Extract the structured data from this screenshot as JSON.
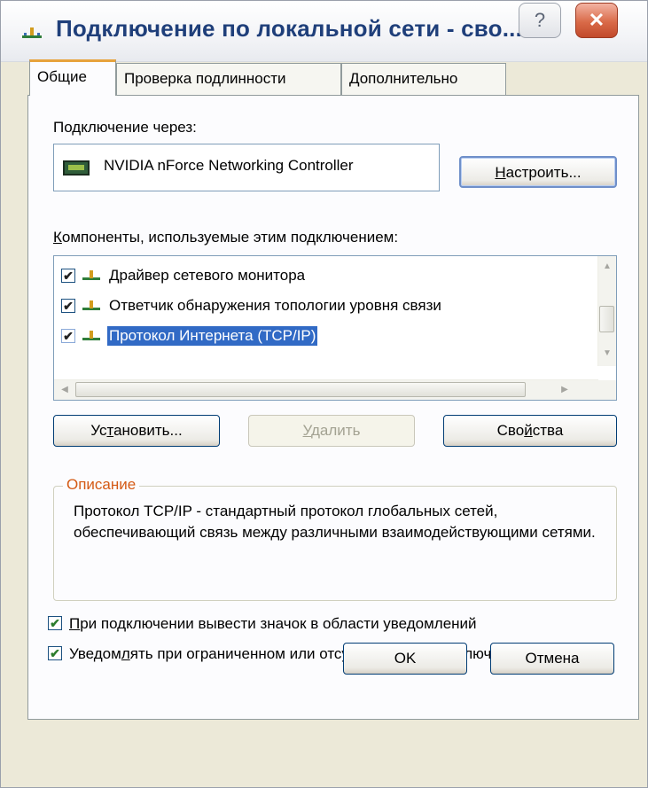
{
  "window": {
    "title": "Подключение по локальной сети - сво...",
    "help_glyph": "?",
    "close_glyph": "✕"
  },
  "tabs": [
    {
      "label": "Общие",
      "active": true
    },
    {
      "label": "Проверка подлинности",
      "active": false
    },
    {
      "label": "Дополнительно",
      "active": false
    }
  ],
  "general": {
    "connect_via_label": "Подключение через:",
    "adapter_name": "NVIDIA nForce Networking Controller",
    "configure_button": {
      "accel": "Н",
      "rest": "астроить..."
    },
    "components_label": {
      "accel": "К",
      "rest": "омпоненты, используемые этим подключением:"
    },
    "components": [
      {
        "label": "Драйвер сетевого монитора",
        "checked": true,
        "selected": false,
        "icon": "network-protocol-icon"
      },
      {
        "label": "Ответчик обнаружения топологии уровня связи",
        "checked": true,
        "selected": false,
        "icon": "network-protocol-icon"
      },
      {
        "label": "Протокол Интернета (TCP/IP)",
        "checked": true,
        "selected": true,
        "icon": "network-protocol-icon"
      }
    ],
    "install_button": {
      "pre": "Ус",
      "accel": "т",
      "post": "ановить..."
    },
    "remove_button": {
      "accel": "У",
      "post": "далить"
    },
    "properties_button": {
      "pre": "Сво",
      "accel": "й",
      "post": "ства"
    },
    "description_title": "Описание",
    "description_text": "Протокол TCP/IP - стандартный протокол глобальных сетей, обеспечивающий связь между различными взаимодействующими сетями.",
    "show_icon_option": {
      "accel": "П",
      "rest": "ри подключении вывести значок в области уведомлений",
      "checked": true
    },
    "notify_limited_option": {
      "pre": "Уведом",
      "accel": "л",
      "post": "ять при ограниченном или отсутствующем подключении",
      "checked": true
    }
  },
  "footer": {
    "ok_button": "OK",
    "cancel_button": "Отмена"
  },
  "colors": {
    "title_text": "#1f3f7a",
    "selection": "#316ac5",
    "group_title": "#d45a14",
    "active_tab_accent": "#e7a33c"
  }
}
